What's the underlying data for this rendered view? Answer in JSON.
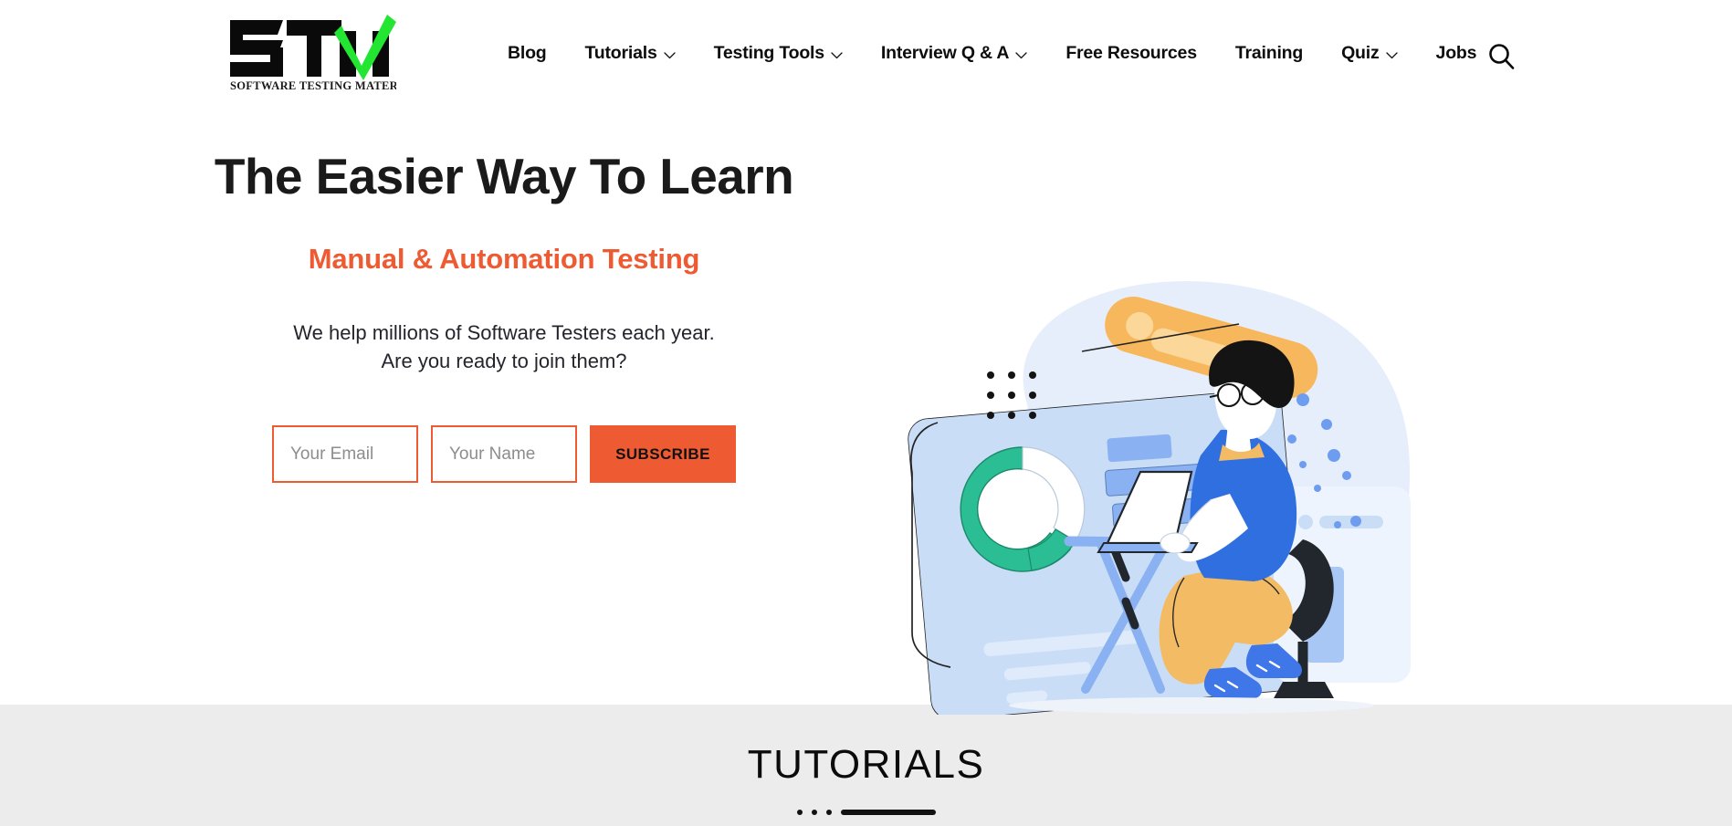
{
  "site": {
    "brand_name": "STM",
    "brand_tagline": "SOFTWARE TESTING MATERIAL",
    "accent_color": "#ee5b32",
    "logo_check_color": "#23e633"
  },
  "header": {
    "logo": {
      "mark_text": "STM",
      "tagline": "SOFTWARE TESTING MATERIAL"
    },
    "nav": [
      {
        "label": "Blog",
        "has_dropdown": false
      },
      {
        "label": "Tutorials",
        "has_dropdown": true
      },
      {
        "label": "Testing Tools",
        "has_dropdown": true
      },
      {
        "label": "Interview Q & A",
        "has_dropdown": true
      },
      {
        "label": "Free Resources",
        "has_dropdown": false
      },
      {
        "label": "Training",
        "has_dropdown": false
      },
      {
        "label": "Quiz",
        "has_dropdown": true
      },
      {
        "label": "Jobs",
        "has_dropdown": false
      }
    ],
    "search": {
      "icon": "search-icon"
    }
  },
  "hero": {
    "title": "The Easier Way To Learn",
    "subtitle": "Manual & Automation Testing",
    "description_line1": "We help millions of Software Testers each year.",
    "description_line2": "Are you ready to join them?",
    "form": {
      "email_placeholder": "Your Email",
      "email_value": "",
      "name_placeholder": "Your Name",
      "name_value": "",
      "submit_label": "SUBSCRIBE"
    },
    "illustration": {
      "name": "person-working-at-desk-illustration",
      "colors": {
        "backdrop": "#e8f0fb",
        "card": "#c9ddf7",
        "donut": "#2bbd93",
        "lamp": "#f7b75c",
        "shirt": "#2f6fe0",
        "pants": "#f3bb63",
        "shoes": "#3f76e8",
        "chair": "#22272e"
      }
    }
  },
  "tutorials_section": {
    "title": "TUTORIALS",
    "divider_dots": 3,
    "background": "#ececec"
  }
}
